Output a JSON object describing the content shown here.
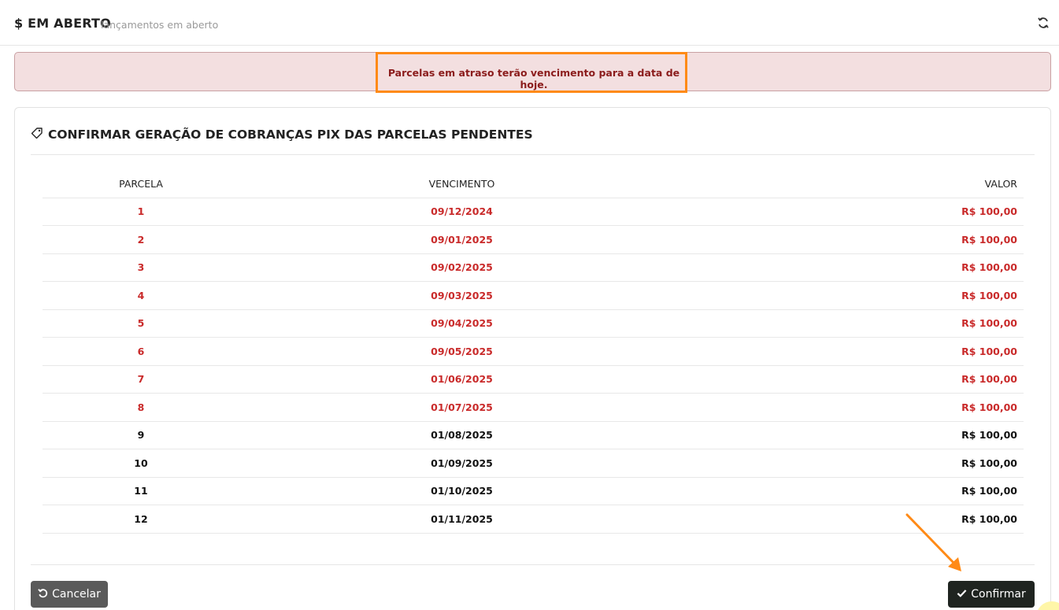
{
  "header": {
    "title": "$ EM ABERTO",
    "subtitle": "lançamentos em aberto",
    "refresh_icon": "refresh-icon"
  },
  "alert": {
    "text": "Parcelas em atraso terão vencimento para a data de hoje."
  },
  "card": {
    "icon": "tag-icon",
    "title": "CONFIRMAR GERAÇÃO DE COBRANÇAS PIX DAS PARCELAS PENDENTES"
  },
  "table": {
    "headers": [
      "PARCELA",
      "VENCIMENTO",
      "VALOR"
    ],
    "rows": [
      {
        "parcela": "1",
        "vencimento": "09/12/2024",
        "valor": "R$ 100,00"
      },
      {
        "parcela": "2",
        "vencimento": "09/01/2025",
        "valor": "R$ 100,00"
      },
      {
        "parcela": "3",
        "vencimento": "09/02/2025",
        "valor": "R$ 100,00"
      },
      {
        "parcela": "4",
        "vencimento": "09/03/2025",
        "valor": "R$ 100,00"
      },
      {
        "parcela": "5",
        "vencimento": "09/04/2025",
        "valor": "R$ 100,00"
      },
      {
        "parcela": "6",
        "vencimento": "09/05/2025",
        "valor": "R$ 100,00"
      },
      {
        "parcela": "7",
        "vencimento": "01/06/2025",
        "valor": "R$ 100,00"
      },
      {
        "parcela": "8",
        "vencimento": "01/07/2025",
        "valor": "R$ 100,00"
      },
      {
        "parcela": "9",
        "vencimento": "01/08/2025",
        "valor": "R$ 100,00"
      },
      {
        "parcela": "10",
        "vencimento": "01/09/2025",
        "valor": "R$ 100,00"
      },
      {
        "parcela": "11",
        "vencimento": "01/10/2025",
        "valor": "R$ 100,00"
      },
      {
        "parcela": "12",
        "vencimento": "01/11/2025",
        "valor": "R$ 100,00"
      }
    ]
  },
  "buttons": {
    "cancel_label": "Cancelar",
    "confirm_label": "Confirmar"
  },
  "colors": {
    "late": "#c92a2a",
    "highlight": "#ff8a16",
    "alert_bg": "#f3dfe0"
  }
}
